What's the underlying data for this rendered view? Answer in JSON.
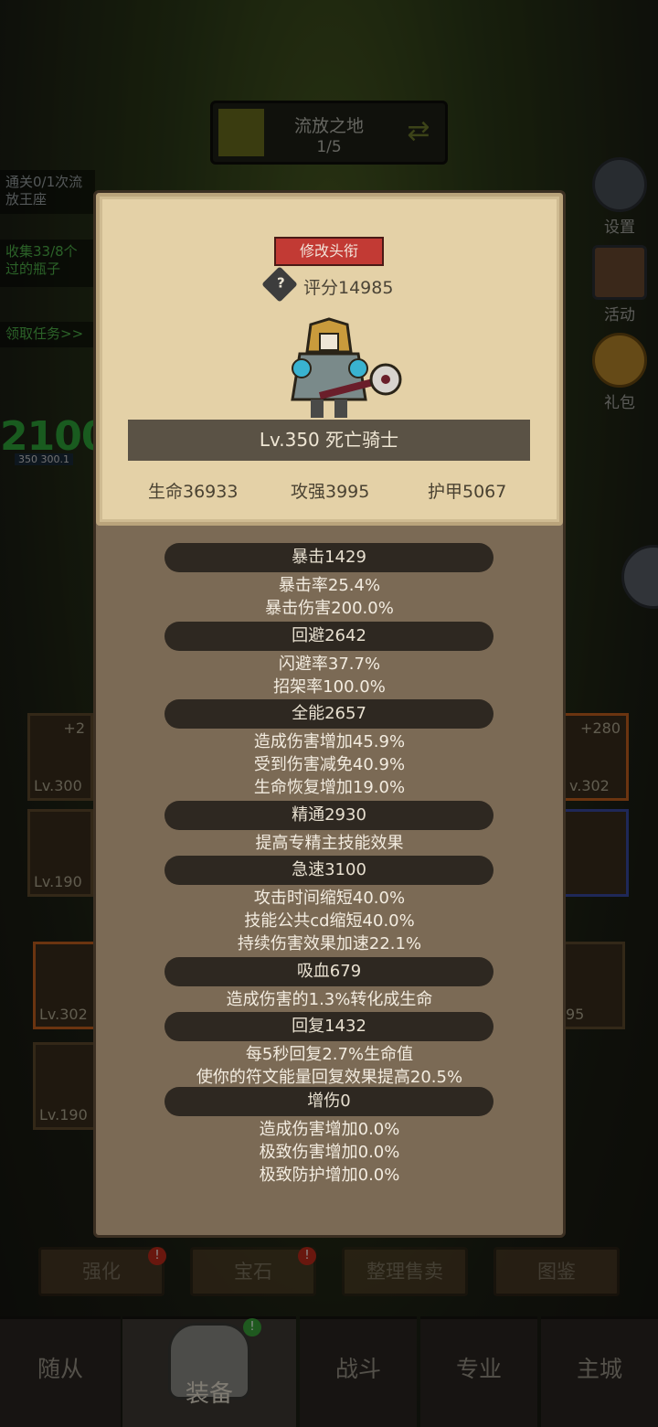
{
  "stage": {
    "name": "流放之地",
    "progress": "1/5"
  },
  "quests": [
    "通关0/1次流放王座",
    "收集33/8个过的瓶子",
    "领取任务>>"
  ],
  "side": {
    "score": "2100",
    "level": "350",
    "sub": "300.1"
  },
  "right_menu": {
    "settings": "设置",
    "activity": "活动",
    "gift": "礼包"
  },
  "slots": {
    "left": [
      {
        "plus": "+2",
        "level": "Lv.300"
      },
      {
        "plus": "",
        "level": "Lv.190"
      },
      {
        "plus": "",
        "level": "Lv.302"
      },
      {
        "plus": "",
        "level": "Lv.190"
      }
    ],
    "right": [
      {
        "plus": "+280",
        "level": "v.302"
      },
      {
        "plus": "",
        "level": ""
      },
      {
        "plus": "",
        "level": "95"
      }
    ]
  },
  "actions": [
    "强化",
    "宝石",
    "整理售卖",
    "图鉴"
  ],
  "nav": [
    "随从",
    "装备",
    "战斗",
    "专业",
    "主城"
  ],
  "card": {
    "title_button": "修改头衔",
    "score": "评分14985",
    "hero_name": "Lv.350 死亡骑士",
    "life": "生命36933",
    "attack": "攻强3995",
    "armor": "护甲5067"
  },
  "stats": [
    {
      "header": "暴击1429",
      "lines": [
        "暴击率25.4%",
        "暴击伤害200.0%"
      ]
    },
    {
      "header": "回避2642",
      "lines": [
        "闪避率37.7%",
        "招架率100.0%"
      ]
    },
    {
      "header": "全能2657",
      "lines": [
        "造成伤害增加45.9%",
        "受到伤害减免40.9%",
        "生命恢复增加19.0%"
      ]
    },
    {
      "header": "精通2930",
      "lines": [
        "提高专精主技能效果"
      ]
    },
    {
      "header": "急速3100",
      "lines": [
        "攻击时间缩短40.0%",
        "技能公共cd缩短40.0%",
        "持续伤害效果加速22.1%"
      ]
    },
    {
      "header": "吸血679",
      "lines": [
        "造成伤害的1.3%转化成生命"
      ]
    },
    {
      "header": "回复1432",
      "lines": [
        "每5秒回复2.7%生命值",
        "使你的符文能量回复效果提高20.5%"
      ]
    },
    {
      "header": "增伤0",
      "lines": [
        "造成伤害增加0.0%",
        "极致伤害增加0.0%",
        "极致防护增加0.0%"
      ]
    }
  ]
}
